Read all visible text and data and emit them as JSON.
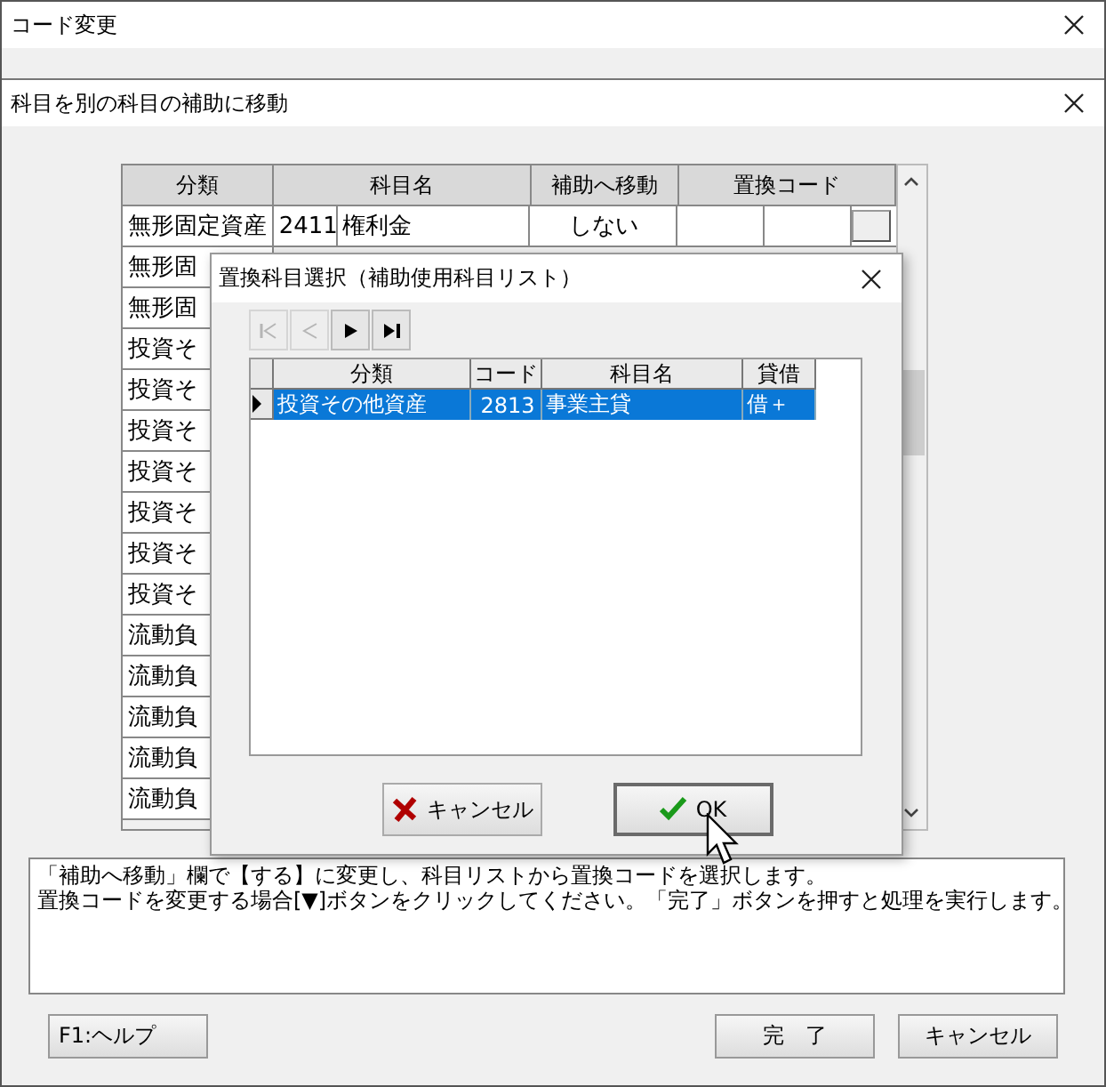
{
  "window": {
    "title": "コード変更"
  },
  "panel": {
    "title": "科目を別の科目の補助に移動"
  },
  "table": {
    "columns": [
      "分類",
      "科目名",
      "補助へ移動",
      "置換コード"
    ],
    "rows": [
      {
        "category": "無形固定資産",
        "code": "2411",
        "name": "権利金",
        "move": "しない"
      },
      {
        "category": "無形固"
      },
      {
        "category": "無形固"
      },
      {
        "category": "投資そ"
      },
      {
        "category": "投資そ"
      },
      {
        "category": "投資そ"
      },
      {
        "category": "投資そ"
      },
      {
        "category": "投資そ"
      },
      {
        "category": "投資そ"
      },
      {
        "category": "投資そ"
      },
      {
        "category": "流動負"
      },
      {
        "category": "流動負"
      },
      {
        "category": "流動負"
      },
      {
        "category": "流動負"
      },
      {
        "category": "流動負"
      }
    ]
  },
  "dialog": {
    "title": "置換科目選択（補助使用科目リスト）",
    "nav_buttons": [
      {
        "kind": "first",
        "disabled": true
      },
      {
        "kind": "prev",
        "disabled": true
      },
      {
        "kind": "next",
        "disabled": false
      },
      {
        "kind": "last",
        "disabled": false
      }
    ],
    "columns": [
      "分類",
      "コード",
      "科目名",
      "貸借"
    ],
    "rows": [
      {
        "cells": [
          "投資その他資産",
          "2813",
          "事業主貸",
          "借＋"
        ],
        "selected": true
      }
    ],
    "buttons": [
      {
        "kind": "cancel",
        "label": "キャンセル",
        "focused": false
      },
      {
        "kind": "ok",
        "label": "OK",
        "focused": true
      }
    ]
  },
  "info": [
    "「補助へ移動」欄で【する】に変更し、科目リストから置換コードを選択します。",
    "置換コードを変更する場合[▼]ボタンをクリックしてください。「完了」ボタンを押すと処理を実行します。"
  ],
  "buttons": [
    {
      "kind": "help",
      "label": "F1:ヘルプ"
    },
    {
      "kind": "done",
      "label": "完　了"
    },
    {
      "kind": "cancel",
      "label": "キャンセル"
    }
  ]
}
